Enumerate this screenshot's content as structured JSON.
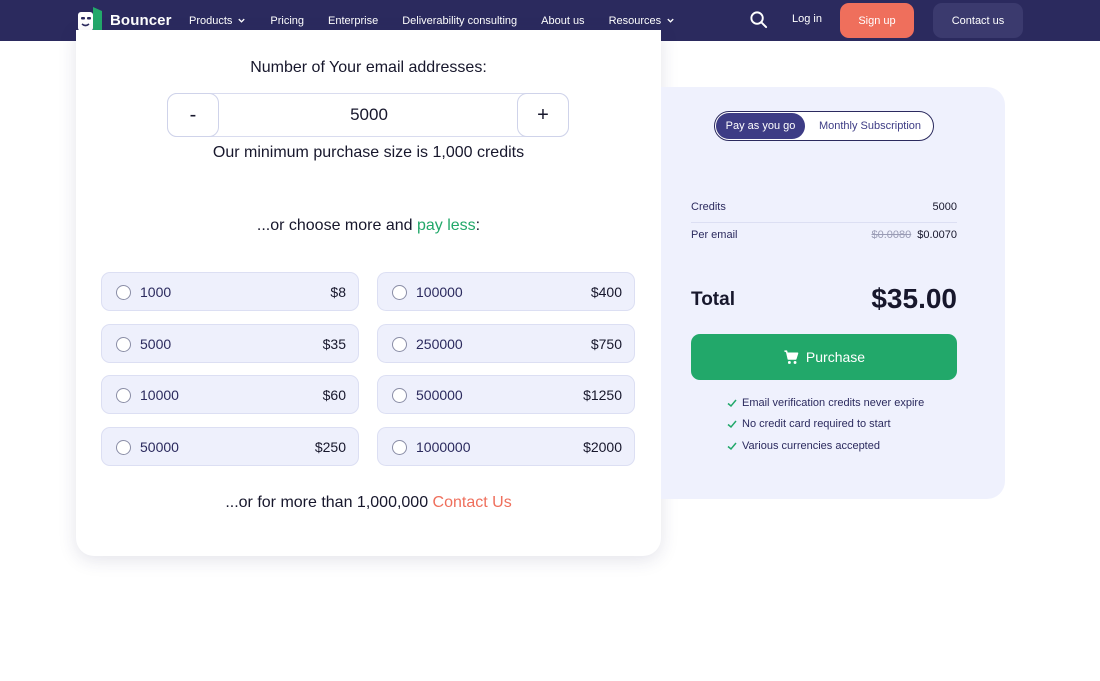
{
  "nav": {
    "brand": "Bouncer",
    "items": [
      {
        "label": "Products",
        "has_dropdown": true
      },
      {
        "label": "Pricing",
        "has_dropdown": false
      },
      {
        "label": "Enterprise",
        "has_dropdown": false
      },
      {
        "label": "Deliverability consulting",
        "has_dropdown": false
      },
      {
        "label": "About us",
        "has_dropdown": false
      },
      {
        "label": "Resources",
        "has_dropdown": true
      }
    ],
    "login": "Log in",
    "signup": "Sign up",
    "contact": "Contact us",
    "icons": [
      "search-icon",
      "chevron-down-icon"
    ]
  },
  "calculator": {
    "title": "Number of Your email addresses:",
    "minus_label": "-",
    "plus_label": "+",
    "value": "5000",
    "min_note": "Our minimum purchase size is 1,000 credits",
    "choose_prefix": "...or choose more and ",
    "choose_highlight": "pay less",
    "choose_suffix": ":",
    "options": [
      {
        "amount": "1000",
        "price": "$8"
      },
      {
        "amount": "100000",
        "price": "$400"
      },
      {
        "amount": "5000",
        "price": "$35"
      },
      {
        "amount": "250000",
        "price": "$750"
      },
      {
        "amount": "10000",
        "price": "$60"
      },
      {
        "amount": "500000",
        "price": "$1250"
      },
      {
        "amount": "50000",
        "price": "$250"
      },
      {
        "amount": "1000000",
        "price": "$2000"
      }
    ],
    "more_prefix": "...or for more than 1,000,000 ",
    "more_link": "Contact Us"
  },
  "summary": {
    "toggle_active": "Pay as you go",
    "toggle_inactive": "Monthly Subscription",
    "credits_label": "Credits",
    "credits_value": "5000",
    "per_email_label": "Per email",
    "per_email_old": "$0.0080",
    "per_email_new": "$0.0070",
    "total_label": "Total",
    "total_value": "$35.00",
    "purchase_label": "Purchase",
    "features": [
      "Email verification credits never expire",
      "No credit card required to start",
      "Various currencies accepted"
    ]
  },
  "colors": {
    "nav_bg": "#2b2a5e",
    "accent_green": "#22a86a",
    "accent_orange": "#ef6f5c",
    "panel_bg": "#eff1fd"
  }
}
